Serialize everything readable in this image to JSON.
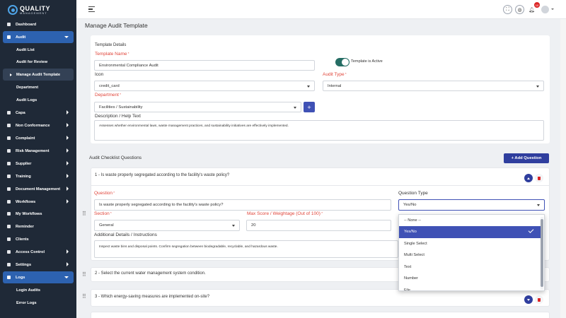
{
  "brand": {
    "title": "QUALITY",
    "subtitle": "MANAGEMENT"
  },
  "sidebar": {
    "items": [
      {
        "label": "Dashboard"
      },
      {
        "label": "Audit"
      },
      {
        "label": "Audit List"
      },
      {
        "label": "Audit for Review"
      },
      {
        "label": "Manage Audit Template"
      },
      {
        "label": "Department"
      },
      {
        "label": "Audit Logs"
      },
      {
        "label": "Capa"
      },
      {
        "label": "Non Conformance"
      },
      {
        "label": "Complaint"
      },
      {
        "label": "Risk Management"
      },
      {
        "label": "Supplier"
      },
      {
        "label": "Training"
      },
      {
        "label": "Document Management"
      },
      {
        "label": "Workflows"
      },
      {
        "label": "My Workflows"
      },
      {
        "label": "Reminder"
      },
      {
        "label": "Clients"
      },
      {
        "label": "Access Control"
      },
      {
        "label": "Settings"
      },
      {
        "label": "Logs"
      },
      {
        "label": "Login Audits"
      },
      {
        "label": "Error Logs"
      }
    ]
  },
  "topbar": {
    "notification_count": "10"
  },
  "page": {
    "title": "Manage Audit Template"
  },
  "template": {
    "section_label": "Template Details",
    "name_label": "Template Name",
    "name_value": "Environmental Compliance Audit",
    "active_label": "Template is Active",
    "icon_label": "Icon",
    "icon_value": "credit_card",
    "audit_type_label": "Audit Type",
    "audit_type_value": "Internal",
    "department_label": "Department",
    "department_value": "Facilities / Sustainability",
    "description_label": "Description / Help Text",
    "description_value": "Assesses whether environmental laws, waste management practices, and sustainability initiatives are effectively implemented."
  },
  "questions": {
    "section_label": "Audit Checklist Questions",
    "add_label": "+ Add Question",
    "q1_header": "1 - Is waste properly segregated according to the facility's waste policy?",
    "question_label": "Question",
    "question_value": "Is waste properly segregated according to the facility's waste policy?",
    "type_label": "Question Type",
    "type_value": "Yes/No",
    "section_field_label": "Section",
    "section_value": "General",
    "score_label": "Max Score / Weightage (Out of 100)",
    "score_value": "20",
    "details_label": "Additional Details / Instructions",
    "details_value": "Inspect waste bins and disposal points. Confirm segregation between biodegradable, recyclable, and hazardous waste.",
    "q2_header": "2 - Select the current water management system condition.",
    "q3_header": "3 - Which energy-saving measures are implemented on-site?"
  },
  "type_options": [
    "-- None --",
    "Yes/No",
    "Single Select",
    "Multi Select",
    "Text",
    "Number",
    "File"
  ]
}
